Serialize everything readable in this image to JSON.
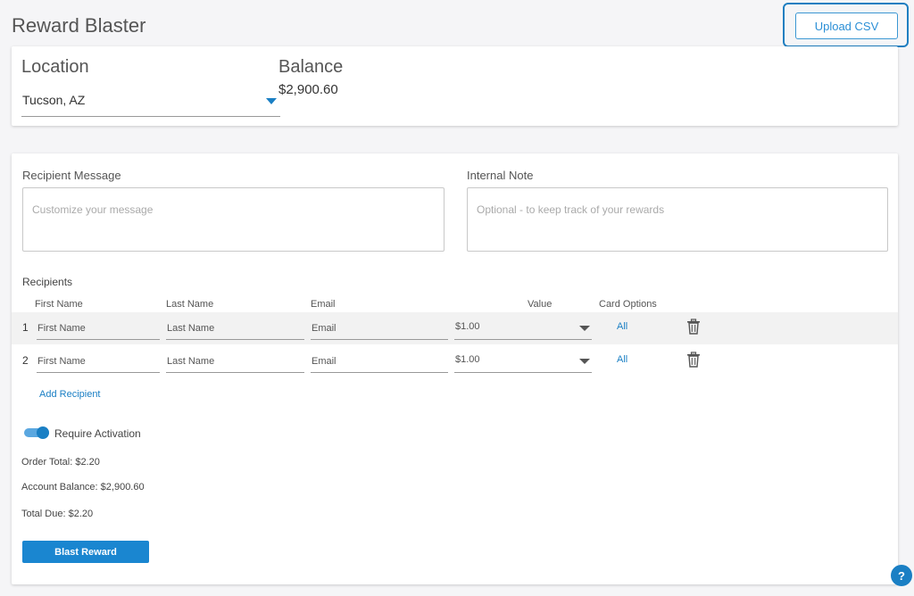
{
  "page": {
    "title": "Reward Blaster"
  },
  "toolbar": {
    "upload_label": "Upload CSV"
  },
  "location": {
    "label": "Location",
    "value": "Tucson, AZ"
  },
  "balance": {
    "label": "Balance",
    "value": "$2,900.60"
  },
  "message": {
    "label": "Recipient Message",
    "placeholder": "Customize your message"
  },
  "note": {
    "label": "Internal Note",
    "placeholder": "Optional - to keep track of your rewards"
  },
  "recipients": {
    "label": "Recipients",
    "columns": {
      "first_name": "First Name",
      "last_name": "Last Name",
      "email": "Email",
      "value": "Value",
      "card_options": "Card Options"
    },
    "rows": [
      {
        "num": "1",
        "first_placeholder": "First Name",
        "last_placeholder": "Last Name",
        "email_placeholder": "Email",
        "value": "$1.00",
        "card_option": "All"
      },
      {
        "num": "2",
        "first_placeholder": "First Name",
        "last_placeholder": "Last Name",
        "email_placeholder": "Email",
        "value": "$1.00",
        "card_option": "All"
      }
    ],
    "add_label": "Add Recipient"
  },
  "activation": {
    "label": "Require Activation",
    "enabled": true
  },
  "summary": {
    "order_total": "Order Total: $2.20",
    "account_balance": "Account Balance: $2,900.60",
    "total_due": "Total Due: $2.20"
  },
  "actions": {
    "blast_label": "Blast Reward"
  },
  "help": {
    "label": "?"
  },
  "colors": {
    "accent": "#1a7fc4",
    "button": "#1a86d0",
    "toggle_track": "#5aa7e0"
  }
}
